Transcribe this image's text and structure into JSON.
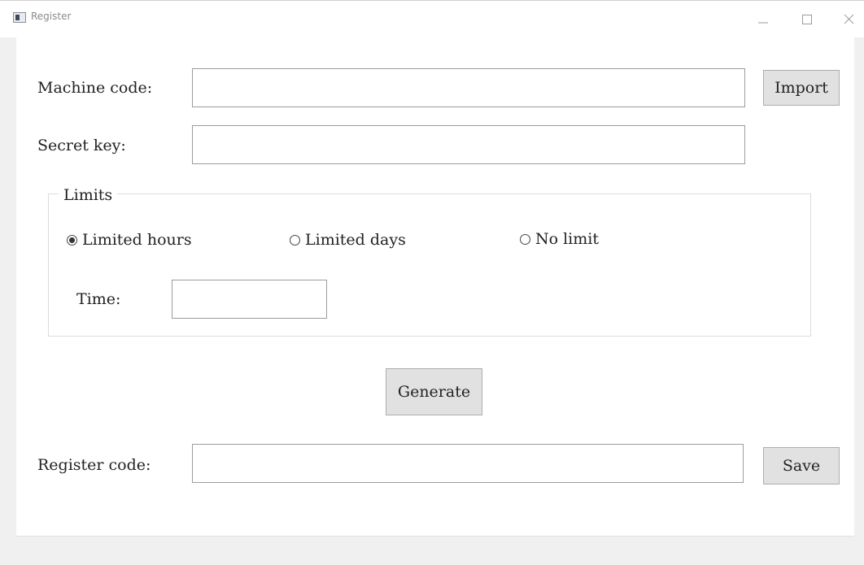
{
  "window": {
    "title": "Register",
    "icon": "app-window-icon",
    "controls": [
      "minimize-icon",
      "maximize-icon",
      "close-icon"
    ]
  },
  "form": {
    "machine_code": {
      "label": "Machine code:",
      "value": ""
    },
    "import_label": "Import",
    "secret_key": {
      "label": "Secret key:",
      "value": ""
    },
    "limits": {
      "title": "Limits",
      "options": [
        {
          "label": "Limited hours",
          "checked": true
        },
        {
          "label": "Limited days",
          "checked": false
        },
        {
          "label": "No limit",
          "checked": false
        }
      ],
      "time": {
        "label": "Time:",
        "value": ""
      }
    },
    "generate_label": "Generate",
    "register_code": {
      "label": "Register code:",
      "value": ""
    },
    "save_label": "Save"
  },
  "colors": {
    "window_bg": "#f0f0f0",
    "client_bg": "#ffffff",
    "button_bg": "#e1e1e1",
    "button_border": "#adadad",
    "input_border": "#9b9b9b"
  }
}
